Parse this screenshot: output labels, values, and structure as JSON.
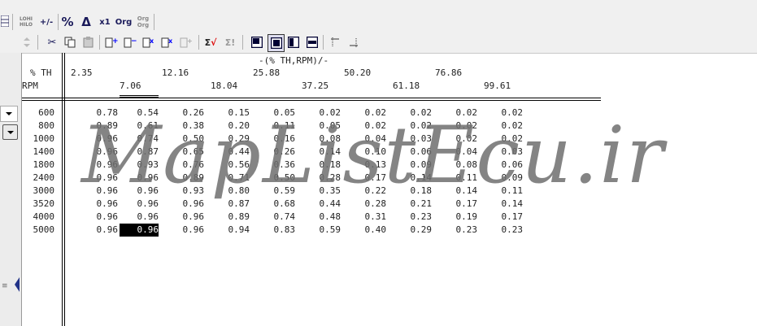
{
  "toolbar_top": {
    "buttons": [
      {
        "label": "3D",
        "icon": "grid-icon"
      },
      {
        "label": "LOHI HILO",
        "icon": "lohi-hilo-icon"
      },
      {
        "label": "+/-",
        "icon": "plus-minus-icon"
      },
      {
        "label": "%",
        "icon": "percent-icon"
      },
      {
        "label": "Δ",
        "icon": "delta-icon"
      },
      {
        "label": "x1",
        "icon": "multiply-icon"
      },
      {
        "label": "Org",
        "icon": "original-icon"
      },
      {
        "label": "Org Org",
        "icon": "original-compare-icon"
      }
    ]
  },
  "table": {
    "title": "-(% TH,RPM)/-",
    "row_axis_label": "RPM",
    "col_axis_label": "% TH",
    "col_headers_top": [
      "2.35",
      "12.16",
      "25.88",
      "50.20",
      "76.86"
    ],
    "col_headers_bottom": [
      "7.06",
      "18.04",
      "37.25",
      "61.18",
      "99.61"
    ],
    "rows": [
      {
        "rpm": "600",
        "values": [
          "0.78",
          "0.54",
          "0.26",
          "0.15",
          "0.05",
          "0.02",
          "0.02",
          "0.02",
          "0.02",
          "0.02"
        ]
      },
      {
        "rpm": "800",
        "values": [
          "0.89",
          "0.61",
          "0.38",
          "0.20",
          "0.11",
          "0.05",
          "0.02",
          "0.02",
          "0.02",
          "0.02"
        ]
      },
      {
        "rpm": "1000",
        "values": [
          "0.96",
          "0.74",
          "0.50",
          "0.29",
          "0.16",
          "0.08",
          "0.04",
          "0.03",
          "0.02",
          "0.02"
        ]
      },
      {
        "rpm": "1400",
        "values": [
          "0.96",
          "0.87",
          "0.65",
          "0.44",
          "0.26",
          "0.14",
          "0.10",
          "0.06",
          "0.04",
          "0.03"
        ]
      },
      {
        "rpm": "1800",
        "values": [
          "0.96",
          "0.93",
          "0.76",
          "0.56",
          "0.36",
          "0.18",
          "0.13",
          "0.09",
          "0.08",
          "0.06"
        ]
      },
      {
        "rpm": "2400",
        "values": [
          "0.96",
          "0.96",
          "0.89",
          "0.71",
          "0.50",
          "0.28",
          "0.17",
          "0.14",
          "0.11",
          "0.09"
        ]
      },
      {
        "rpm": "3000",
        "values": [
          "0.96",
          "0.96",
          "0.93",
          "0.80",
          "0.59",
          "0.35",
          "0.22",
          "0.18",
          "0.14",
          "0.11"
        ]
      },
      {
        "rpm": "3520",
        "values": [
          "0.96",
          "0.96",
          "0.96",
          "0.87",
          "0.68",
          "0.44",
          "0.28",
          "0.21",
          "0.17",
          "0.14"
        ]
      },
      {
        "rpm": "4000",
        "values": [
          "0.96",
          "0.96",
          "0.96",
          "0.89",
          "0.74",
          "0.48",
          "0.31",
          "0.23",
          "0.19",
          "0.17"
        ]
      },
      {
        "rpm": "5000",
        "values": [
          "0.96",
          "0.96",
          "0.96",
          "0.94",
          "0.83",
          "0.59",
          "0.40",
          "0.29",
          "0.23",
          "0.23"
        ]
      }
    ],
    "selected_cell": {
      "row": 9,
      "col": 1
    }
  },
  "watermark": "MapListEcu.ir"
}
